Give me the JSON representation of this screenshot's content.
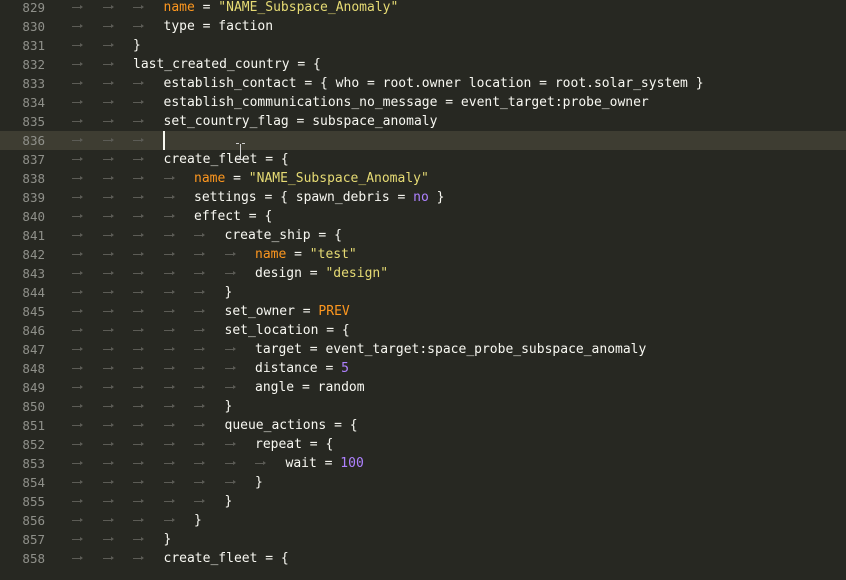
{
  "editor": {
    "active_line": "836",
    "lines": [
      {
        "num": "829",
        "indent": 3,
        "tokens": [
          [
            "name",
            "tok-key"
          ],
          [
            " = ",
            "tok-plain"
          ],
          [
            "\"NAME_Subspace_Anomaly\"",
            "tok-str"
          ]
        ]
      },
      {
        "num": "830",
        "indent": 3,
        "tokens": [
          [
            "type = faction",
            "tok-plain"
          ]
        ]
      },
      {
        "num": "831",
        "indent": 2,
        "tokens": [
          [
            "}",
            "tok-plain"
          ]
        ]
      },
      {
        "num": "832",
        "indent": 2,
        "tokens": [
          [
            "last_created_country = {",
            "tok-plain"
          ]
        ]
      },
      {
        "num": "833",
        "indent": 3,
        "tokens": [
          [
            "establish_contact = { who = root.owner location = root.solar_system }",
            "tok-plain"
          ]
        ]
      },
      {
        "num": "834",
        "indent": 3,
        "tokens": [
          [
            "establish_communications_no_message = event_target:probe_owner",
            "tok-plain"
          ]
        ]
      },
      {
        "num": "835",
        "indent": 3,
        "tokens": [
          [
            "set_country_flag = subspace_anomaly",
            "tok-plain"
          ]
        ]
      },
      {
        "num": "836",
        "indent": 3,
        "tokens": [],
        "caret": true
      },
      {
        "num": "837",
        "indent": 3,
        "tokens": [
          [
            "create_fleet = {",
            "tok-plain"
          ]
        ]
      },
      {
        "num": "838",
        "indent": 4,
        "tokens": [
          [
            "name",
            "tok-key"
          ],
          [
            " = ",
            "tok-plain"
          ],
          [
            "\"NAME_Subspace_Anomaly\"",
            "tok-str"
          ]
        ]
      },
      {
        "num": "839",
        "indent": 4,
        "tokens": [
          [
            "settings = { spawn_debris = ",
            "tok-plain"
          ],
          [
            "no",
            "tok-const"
          ],
          [
            " }",
            "tok-plain"
          ]
        ]
      },
      {
        "num": "840",
        "indent": 4,
        "tokens": [
          [
            "effect = {",
            "tok-plain"
          ]
        ]
      },
      {
        "num": "841",
        "indent": 5,
        "tokens": [
          [
            "create_ship = {",
            "tok-plain"
          ]
        ]
      },
      {
        "num": "842",
        "indent": 6,
        "tokens": [
          [
            "name",
            "tok-key"
          ],
          [
            " = ",
            "tok-plain"
          ],
          [
            "\"test\"",
            "tok-str"
          ]
        ]
      },
      {
        "num": "843",
        "indent": 6,
        "tokens": [
          [
            "design = ",
            "tok-plain"
          ],
          [
            "\"design\"",
            "tok-str"
          ]
        ]
      },
      {
        "num": "844",
        "indent": 5,
        "tokens": [
          [
            "}",
            "tok-plain"
          ]
        ]
      },
      {
        "num": "845",
        "indent": 5,
        "tokens": [
          [
            "set_owner = ",
            "tok-plain"
          ],
          [
            "PREV",
            "tok-kw"
          ]
        ]
      },
      {
        "num": "846",
        "indent": 5,
        "tokens": [
          [
            "set_location = {",
            "tok-plain"
          ]
        ]
      },
      {
        "num": "847",
        "indent": 6,
        "tokens": [
          [
            "target = event_target:space_probe_subspace_anomaly",
            "tok-plain"
          ]
        ]
      },
      {
        "num": "848",
        "indent": 6,
        "tokens": [
          [
            "distance = ",
            "tok-plain"
          ],
          [
            "5",
            "tok-num"
          ]
        ]
      },
      {
        "num": "849",
        "indent": 6,
        "tokens": [
          [
            "angle = random",
            "tok-plain"
          ]
        ]
      },
      {
        "num": "850",
        "indent": 5,
        "tokens": [
          [
            "}",
            "tok-plain"
          ]
        ]
      },
      {
        "num": "851",
        "indent": 5,
        "tokens": [
          [
            "queue_actions = {",
            "tok-plain"
          ]
        ]
      },
      {
        "num": "852",
        "indent": 6,
        "tokens": [
          [
            "repeat = {",
            "tok-plain"
          ]
        ]
      },
      {
        "num": "853",
        "indent": 7,
        "tokens": [
          [
            "wait = ",
            "tok-plain"
          ],
          [
            "100",
            "tok-num"
          ]
        ]
      },
      {
        "num": "854",
        "indent": 6,
        "tokens": [
          [
            "}",
            "tok-plain"
          ]
        ]
      },
      {
        "num": "855",
        "indent": 5,
        "tokens": [
          [
            "}",
            "tok-plain"
          ]
        ]
      },
      {
        "num": "856",
        "indent": 4,
        "tokens": [
          [
            "}",
            "tok-plain"
          ]
        ]
      },
      {
        "num": "857",
        "indent": 3,
        "tokens": [
          [
            "}",
            "tok-plain"
          ]
        ]
      },
      {
        "num": "858",
        "indent": 3,
        "tokens": [
          [
            "create_fleet = {",
            "tok-plain"
          ]
        ]
      }
    ]
  },
  "colors": {
    "background": "#272822",
    "line_number": "#8f908a",
    "text": "#f8f8f2",
    "key": "#fd971f",
    "string": "#e6db74",
    "number": "#ae81ff",
    "active_line": "#3e3d32"
  },
  "cursor_icon": "text-cursor-ibeam-icon"
}
